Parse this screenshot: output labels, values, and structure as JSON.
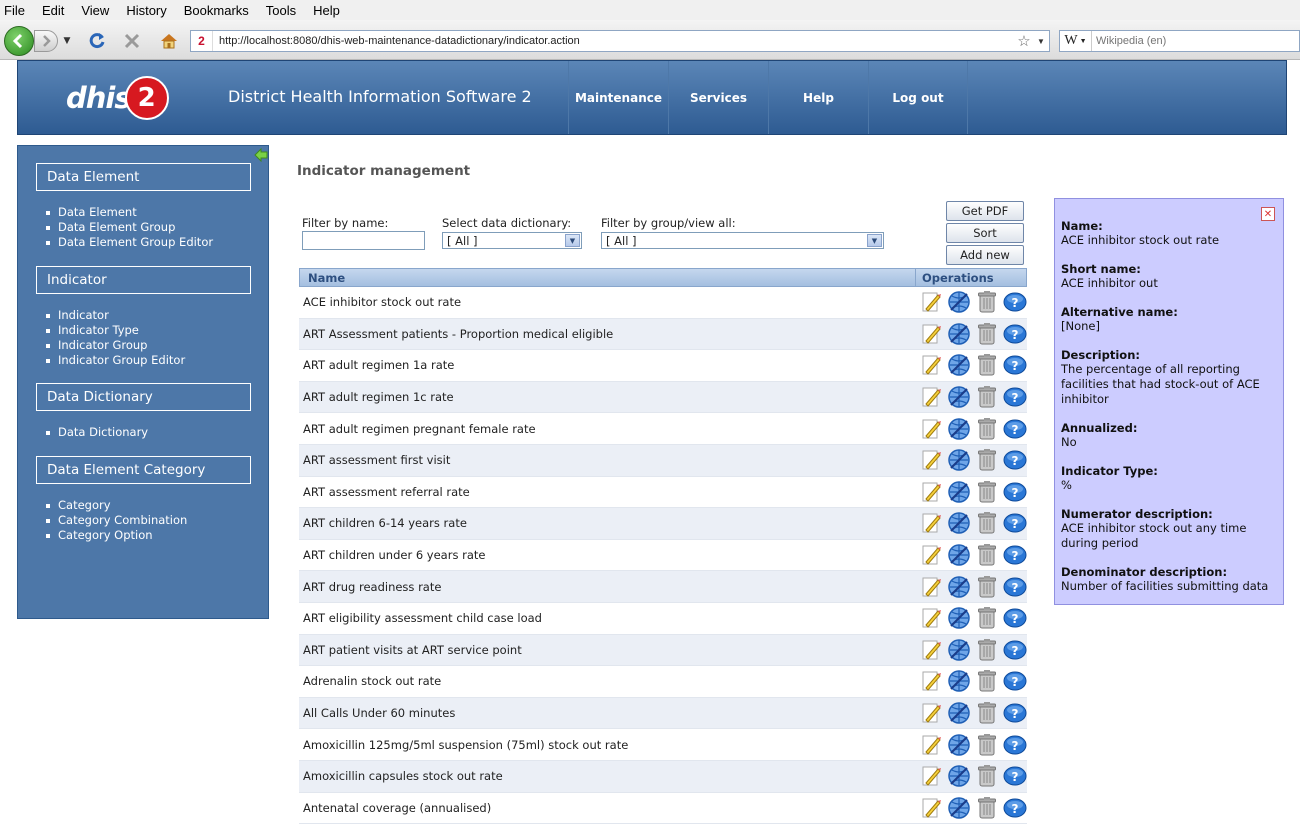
{
  "browser": {
    "menu": [
      "File",
      "Edit",
      "View",
      "History",
      "Bookmarks",
      "Tools",
      "Help"
    ],
    "favicon": "2",
    "url": "http://localhost:8080/dhis-web-maintenance-datadictionary/indicator.action",
    "search_engine": "W",
    "search_placeholder": "Wikipedia (en)"
  },
  "header": {
    "logo_text": "dhis",
    "logo_badge": "2",
    "title": "District Health Information Software 2",
    "menu": [
      "Maintenance",
      "Services",
      "Help",
      "Log out"
    ]
  },
  "sidebar": {
    "sections": [
      {
        "title": "Data Element",
        "items": [
          "Data Element",
          "Data Element Group",
          "Data Element Group Editor"
        ]
      },
      {
        "title": "Indicator",
        "items": [
          "Indicator",
          "Indicator Type",
          "Indicator Group",
          "Indicator Group Editor"
        ]
      },
      {
        "title": "Data Dictionary",
        "items": [
          "Data Dictionary"
        ]
      },
      {
        "title": "Data Element Category",
        "items": [
          "Category",
          "Category Combination",
          "Category Option"
        ]
      }
    ]
  },
  "main": {
    "title": "Indicator management",
    "filter_name_label": "Filter by name:",
    "filter_name_value": "",
    "dictionary_label": "Select data dictionary:",
    "dictionary_value": "[ All ]",
    "group_label": "Filter by group/view all:",
    "group_value": "[ All ]",
    "buttons": {
      "pdf": "Get PDF",
      "sort": "Sort",
      "add": "Add new"
    },
    "columns": {
      "name": "Name",
      "operations": "Operations"
    },
    "rows": [
      "ACE inhibitor stock out rate",
      "ART Assessment patients - Proportion medical eligible",
      "ART adult regimen 1a rate",
      "ART adult regimen 1c rate",
      "ART adult regimen pregnant female rate",
      "ART assessment first visit",
      "ART assessment referral rate",
      "ART children 6-14 years rate",
      "ART children under 6 years rate",
      "ART drug readiness rate",
      "ART eligibility assessment child case load",
      "ART patient visits at ART service point",
      "Adrenalin stock out rate",
      "All Calls Under 60 minutes",
      "Amoxicillin 125mg/5ml suspension (75ml) stock out rate",
      "Amoxicillin capsules stock out rate",
      "Antenatal coverage (annualised)"
    ]
  },
  "detail": {
    "fields": [
      {
        "label": "Name:",
        "value": "ACE inhibitor stock out rate"
      },
      {
        "label": "Short name:",
        "value": "ACE inhibitor out"
      },
      {
        "label": "Alternative name:",
        "value": "[None]"
      },
      {
        "label": "Description:",
        "value": "The percentage of all reporting facilities that had stock-out of ACE inhibitor"
      },
      {
        "label": "Annualized:",
        "value": "No"
      },
      {
        "label": "Indicator Type:",
        "value": "%"
      },
      {
        "label": "Numerator description:",
        "value": "ACE inhibitor stock out any time during period"
      },
      {
        "label": "Denominator description:",
        "value": "Number of facilities submitting data"
      }
    ]
  },
  "colors": {
    "header": "#2e5b92",
    "sidebar": "#4d77a8",
    "detail_bg": "#ccccff",
    "row_alt": "#ebeff6"
  }
}
